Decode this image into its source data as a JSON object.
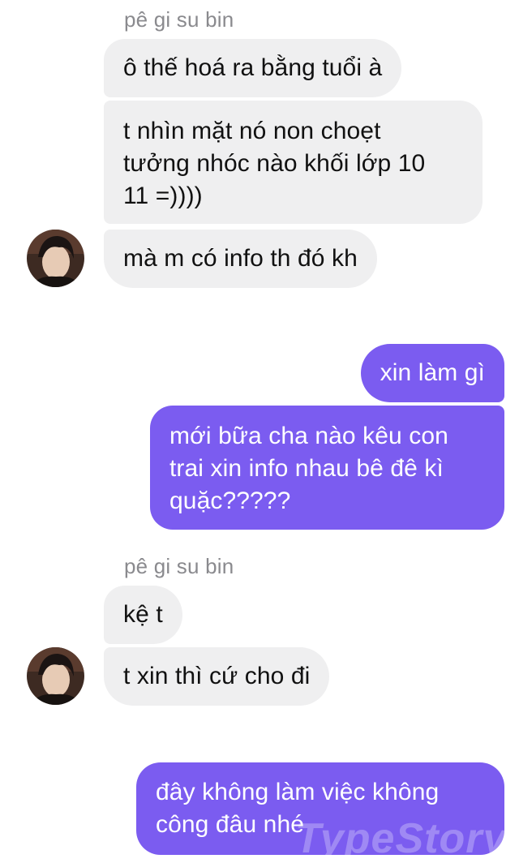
{
  "thread": {
    "groups": [
      {
        "sender": "pê gi su bin",
        "messages": [
          "ô thế hoá ra bằng tuổi à",
          "t nhìn mặt nó non choẹt\ntưởng nhóc nào khối lớp 10\n11 =))))",
          "mà m có info th đó kh"
        ]
      },
      {
        "sender": "me",
        "messages": [
          "xin làm gì",
          "mới bữa cha nào kêu con\ntrai xin info nhau bê đê kì\nquặc?????"
        ]
      },
      {
        "sender": "pê gi su bin",
        "messages": [
          "kệ t",
          "t xin thì cứ cho đi"
        ]
      },
      {
        "sender": "me",
        "messages": [
          "đây không làm việc không\ncông đâu nhé"
        ]
      }
    ]
  },
  "watermark": "TypeStory",
  "colors": {
    "incoming_bubble": "#efeff0",
    "outgoing_bubble": "#7b5cf0",
    "sender_name": "#8a8a8e"
  },
  "icons": {
    "avatar": "contact-avatar-photo"
  }
}
